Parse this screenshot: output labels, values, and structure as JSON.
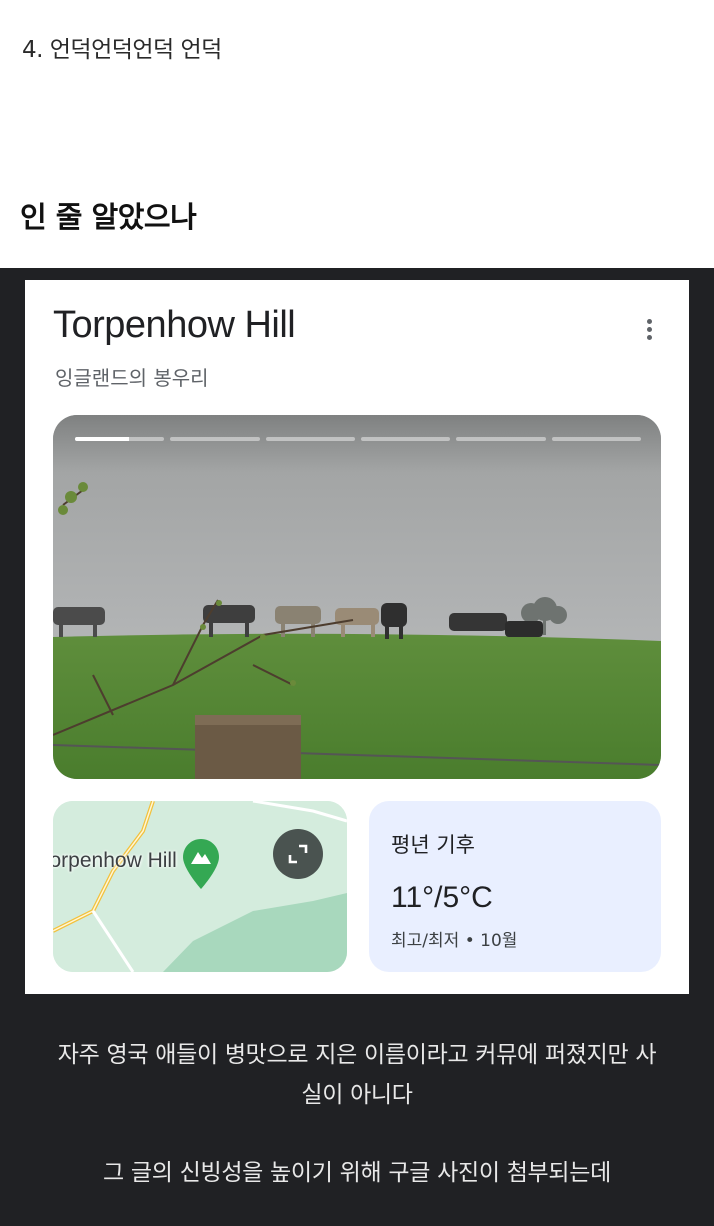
{
  "post": {
    "heading_small": "4. 언덕언덕언덕 언덕",
    "heading_big": "인 줄 알았으나",
    "caption_1_line_1": "자주 영국 애들이 병맛으로 지은 이름이라고 커뮤에 퍼졌지만 사",
    "caption_1_line_2": "실이 아니다",
    "caption_2": "그 글의 신빙성을 높이기 위해 구글 사진이 첨부되는데"
  },
  "place_card": {
    "title": "Torpenhow Hill",
    "subtitle": "잉글랜드의 봉우리",
    "more_icon": "more-vertical-icon",
    "photo": {
      "story_segments": 6,
      "active_segment": 1,
      "active_progress": 0.6
    },
    "map": {
      "label": "Torpenhow Hill",
      "pin_icon": "mountain-pin-icon",
      "expand_icon": "expand-icon"
    },
    "weather": {
      "title": "평년 기후",
      "temperature": "11°/5°C",
      "meta": "최고/최저 • 10월"
    }
  },
  "colors": {
    "dark_background": "#202124",
    "weather_tile": "#e9efff",
    "map_pin": "#34a853"
  }
}
